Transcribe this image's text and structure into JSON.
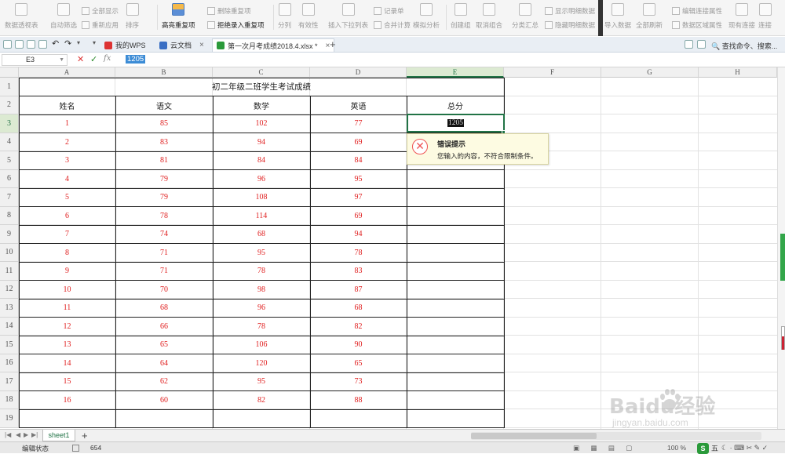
{
  "ribbon": {
    "pivot_table": "数据透视表",
    "auto_filter": "自动筛选",
    "show_all": "全部显示",
    "reapply": "重新应用",
    "sort": "排序",
    "highlight_duplicates": "高亮重复项",
    "remove_duplicates": "删除重复项",
    "reject_duplicates": "拒绝录入重复项",
    "split_column": "分列",
    "validity": "有效性",
    "insert_dropdown": "插入下拉列表",
    "record_form": "记录单",
    "consolidate": "合并计算",
    "simulation": "模拟分析",
    "create_group": "创建组",
    "ungroup": "取消组合",
    "subtotal": "分类汇总",
    "show_detail": "显示明细数据",
    "hide_detail": "隐藏明细数据",
    "import_data": "导入数据",
    "refresh_all": "全部刷新",
    "edit_connection": "编辑连接属性",
    "data_region": "数据区域属性",
    "existing_conn": "现有连接",
    "connect": "连接"
  },
  "tabs": {
    "mywps": "我的WPS",
    "cloud": "云文档",
    "file": "第一次月考成绩2018.4.xlsx *",
    "search_cmd": "查找命令、搜索..."
  },
  "formula": {
    "cell_ref": "E3",
    "fx": "fx",
    "value": "1205"
  },
  "columns": [
    "A",
    "B",
    "C",
    "D",
    "E",
    "F",
    "G",
    "H"
  ],
  "rows": [
    "1",
    "2",
    "3",
    "4",
    "5",
    "6",
    "7",
    "8",
    "9",
    "10",
    "11",
    "12",
    "13",
    "14",
    "15",
    "16",
    "17",
    "18",
    "19"
  ],
  "sheet": {
    "title": "初二年级二班学生考试成绩",
    "headers": [
      "姓名",
      "语文",
      "数学",
      "英语",
      "总分"
    ],
    "data": [
      [
        "1",
        "85",
        "102",
        "77"
      ],
      [
        "2",
        "83",
        "94",
        "69"
      ],
      [
        "3",
        "81",
        "84",
        "84"
      ],
      [
        "4",
        "79",
        "96",
        "95"
      ],
      [
        "5",
        "79",
        "108",
        "97"
      ],
      [
        "6",
        "78",
        "114",
        "69"
      ],
      [
        "7",
        "74",
        "68",
        "94"
      ],
      [
        "8",
        "71",
        "95",
        "78"
      ],
      [
        "9",
        "71",
        "78",
        "83"
      ],
      [
        "10",
        "70",
        "98",
        "87"
      ],
      [
        "11",
        "68",
        "96",
        "68"
      ],
      [
        "12",
        "66",
        "78",
        "82"
      ],
      [
        "13",
        "65",
        "106",
        "90"
      ],
      [
        "14",
        "64",
        "120",
        "65"
      ],
      [
        "15",
        "62",
        "95",
        "73"
      ],
      [
        "16",
        "60",
        "82",
        "88"
      ]
    ],
    "active_value": "1205"
  },
  "error_tip": {
    "title": "错误提示",
    "message": "您输入的内容，不符合限制条件。"
  },
  "sheet_tab": "sheet1",
  "status": {
    "mode": "编辑状态",
    "count": "654",
    "zoom": "100 %",
    "ime": "五"
  },
  "watermark": {
    "brand": "Baidu经验",
    "url": "jingyan.baidu.com"
  },
  "colors": {
    "accent_green": "#217346",
    "data_red": "#e02020",
    "formula_select": "#3c8cd6"
  }
}
